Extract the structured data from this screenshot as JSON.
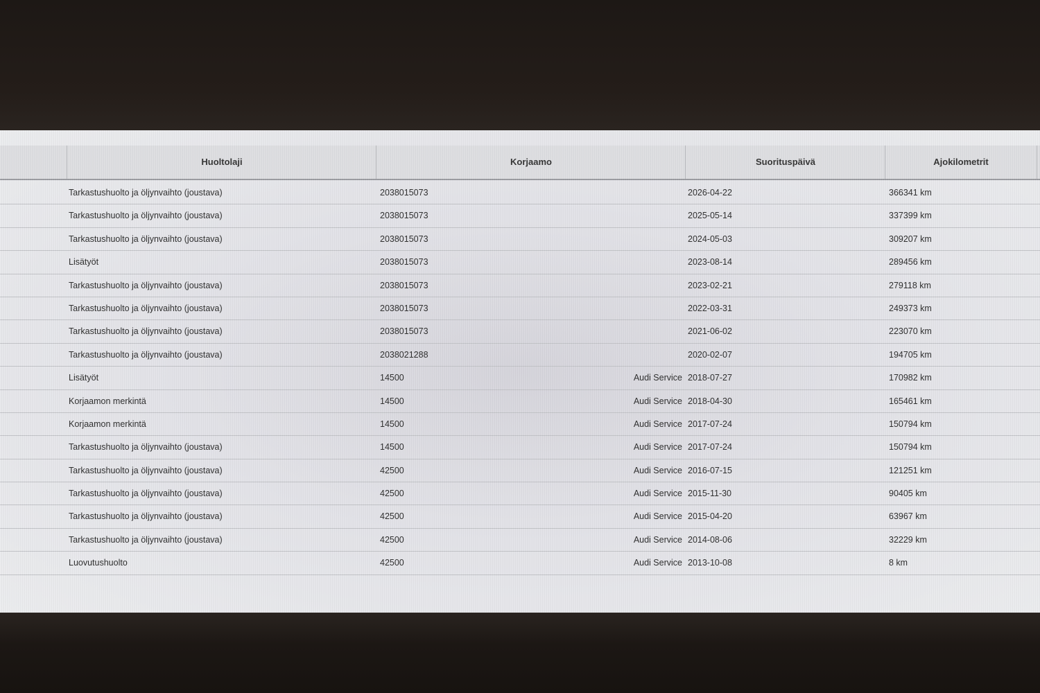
{
  "table": {
    "headers": {
      "first": "",
      "huoltolaji": "Huoltolaji",
      "korjaamo": "Korjaamo",
      "suorituspaiva": "Suorituspäivä",
      "ajokilometrit": "Ajokilometrit"
    },
    "rows": [
      {
        "huoltolaji": "Tarkastushuolto ja öljynvaihto (joustava)",
        "korjaamo_code": "2038015073",
        "korjaamo_name": "",
        "date": "2026-04-22",
        "km": "366341 km"
      },
      {
        "huoltolaji": "Tarkastushuolto ja öljynvaihto (joustava)",
        "korjaamo_code": "2038015073",
        "korjaamo_name": "",
        "date": "2025-05-14",
        "km": "337399 km"
      },
      {
        "huoltolaji": "Tarkastushuolto ja öljynvaihto (joustava)",
        "korjaamo_code": "2038015073",
        "korjaamo_name": "",
        "date": "2024-05-03",
        "km": "309207 km"
      },
      {
        "huoltolaji": "Lisätyöt",
        "korjaamo_code": "2038015073",
        "korjaamo_name": "",
        "date": "2023-08-14",
        "km": "289456 km"
      },
      {
        "huoltolaji": "Tarkastushuolto ja öljynvaihto (joustava)",
        "korjaamo_code": "2038015073",
        "korjaamo_name": "",
        "date": "2023-02-21",
        "km": "279118 km"
      },
      {
        "huoltolaji": "Tarkastushuolto ja öljynvaihto (joustava)",
        "korjaamo_code": "2038015073",
        "korjaamo_name": "",
        "date": "2022-03-31",
        "km": "249373 km"
      },
      {
        "huoltolaji": "Tarkastushuolto ja öljynvaihto (joustava)",
        "korjaamo_code": "2038015073",
        "korjaamo_name": "",
        "date": "2021-06-02",
        "km": "223070 km"
      },
      {
        "huoltolaji": "Tarkastushuolto ja öljynvaihto (joustava)",
        "korjaamo_code": "2038021288",
        "korjaamo_name": "",
        "date": "2020-02-07",
        "km": "194705 km"
      },
      {
        "huoltolaji": "Lisätyöt",
        "korjaamo_code": "14500",
        "korjaamo_name": "Audi Service",
        "date": "2018-07-27",
        "km": "170982 km"
      },
      {
        "huoltolaji": "Korjaamon merkintä",
        "korjaamo_code": "14500",
        "korjaamo_name": "Audi Service",
        "date": "2018-04-30",
        "km": "165461 km"
      },
      {
        "huoltolaji": "Korjaamon merkintä",
        "korjaamo_code": "14500",
        "korjaamo_name": "Audi Service",
        "date": "2017-07-24",
        "km": "150794 km"
      },
      {
        "huoltolaji": "Tarkastushuolto ja öljynvaihto (joustava)",
        "korjaamo_code": "14500",
        "korjaamo_name": "Audi Service",
        "date": "2017-07-24",
        "km": "150794 km"
      },
      {
        "huoltolaji": "Tarkastushuolto ja öljynvaihto (joustava)",
        "korjaamo_code": "42500",
        "korjaamo_name": "Audi Service",
        "date": "2016-07-15",
        "km": "121251 km"
      },
      {
        "huoltolaji": "Tarkastushuolto ja öljynvaihto (joustava)",
        "korjaamo_code": "42500",
        "korjaamo_name": "Audi Service",
        "date": "2015-11-30",
        "km": "90405 km"
      },
      {
        "huoltolaji": "Tarkastushuolto ja öljynvaihto (joustava)",
        "korjaamo_code": "42500",
        "korjaamo_name": "Audi Service",
        "date": "2015-04-20",
        "km": "63967 km"
      },
      {
        "huoltolaji": "Tarkastushuolto ja öljynvaihto (joustava)",
        "korjaamo_code": "42500",
        "korjaamo_name": "Audi Service",
        "date": "2014-08-06",
        "km": "32229 km"
      },
      {
        "huoltolaji": "Luovutushuolto",
        "korjaamo_code": "42500",
        "korjaamo_name": "Audi Service",
        "date": "2013-10-08",
        "km": "8 km"
      }
    ]
  }
}
